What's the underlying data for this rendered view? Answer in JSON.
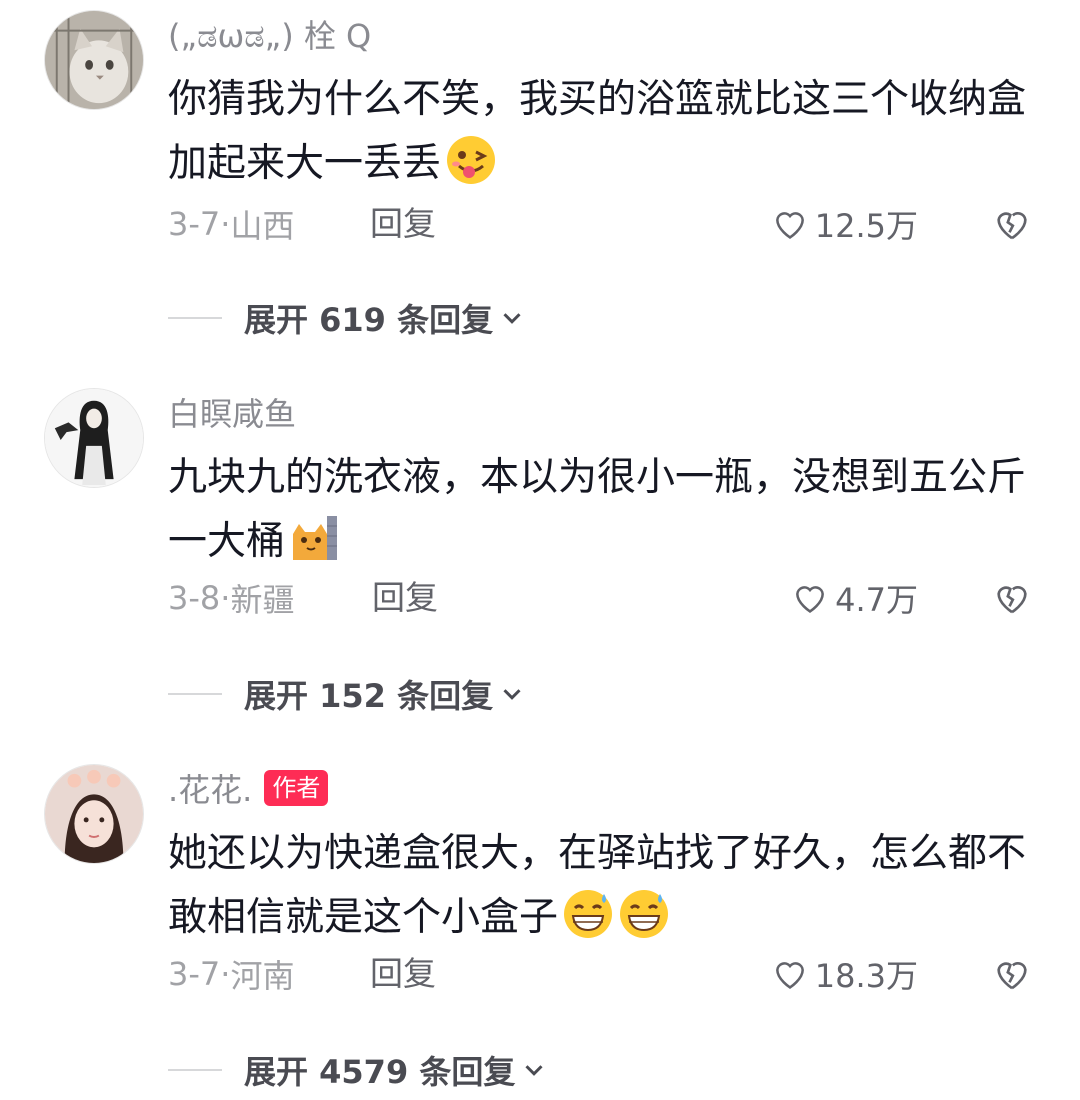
{
  "comments": [
    {
      "author": "(„ಡωಡ„) 栓 Q",
      "is_author": false,
      "text": "你猜我为什么不笑，我买的浴篮就比这三个收纳盒加起来大一丢丢",
      "emoji": [
        "wink-tongue-emoji"
      ],
      "date": "3-7",
      "location": "山西",
      "reply_label": "回复",
      "likes": "12.5万",
      "expand_label": "展开 619 条回复",
      "avatar": "cat-avatar"
    },
    {
      "author": "白瞑咸鱼",
      "is_author": false,
      "text": "九块九的洗衣液，本以为很小一瓶，没想到五公斤一大桶",
      "emoji": [
        "peeking-cat-emoji"
      ],
      "date": "3-8",
      "location": "新疆",
      "reply_label": "回复",
      "likes": "4.7万",
      "expand_label": "展开 152 条回复",
      "avatar": "girl-crow-avatar"
    },
    {
      "author": ".花花.",
      "is_author": true,
      "author_tag": "作者",
      "text": "她还以为快递盒很大，在驿站找了好久，怎么都不敢相信就是这个小盒子",
      "emoji": [
        "grin-sweat-emoji",
        "grin-sweat-emoji"
      ],
      "date": "3-7",
      "location": "河南",
      "reply_label": "回复",
      "likes": "18.3万",
      "expand_label": "展开 4579 条回复",
      "avatar": "girl-selfie-avatar"
    }
  ],
  "colors": {
    "author_tag_bg": "#fe2c55",
    "muted_text": "#a1a2a6",
    "body_text": "#161823"
  }
}
